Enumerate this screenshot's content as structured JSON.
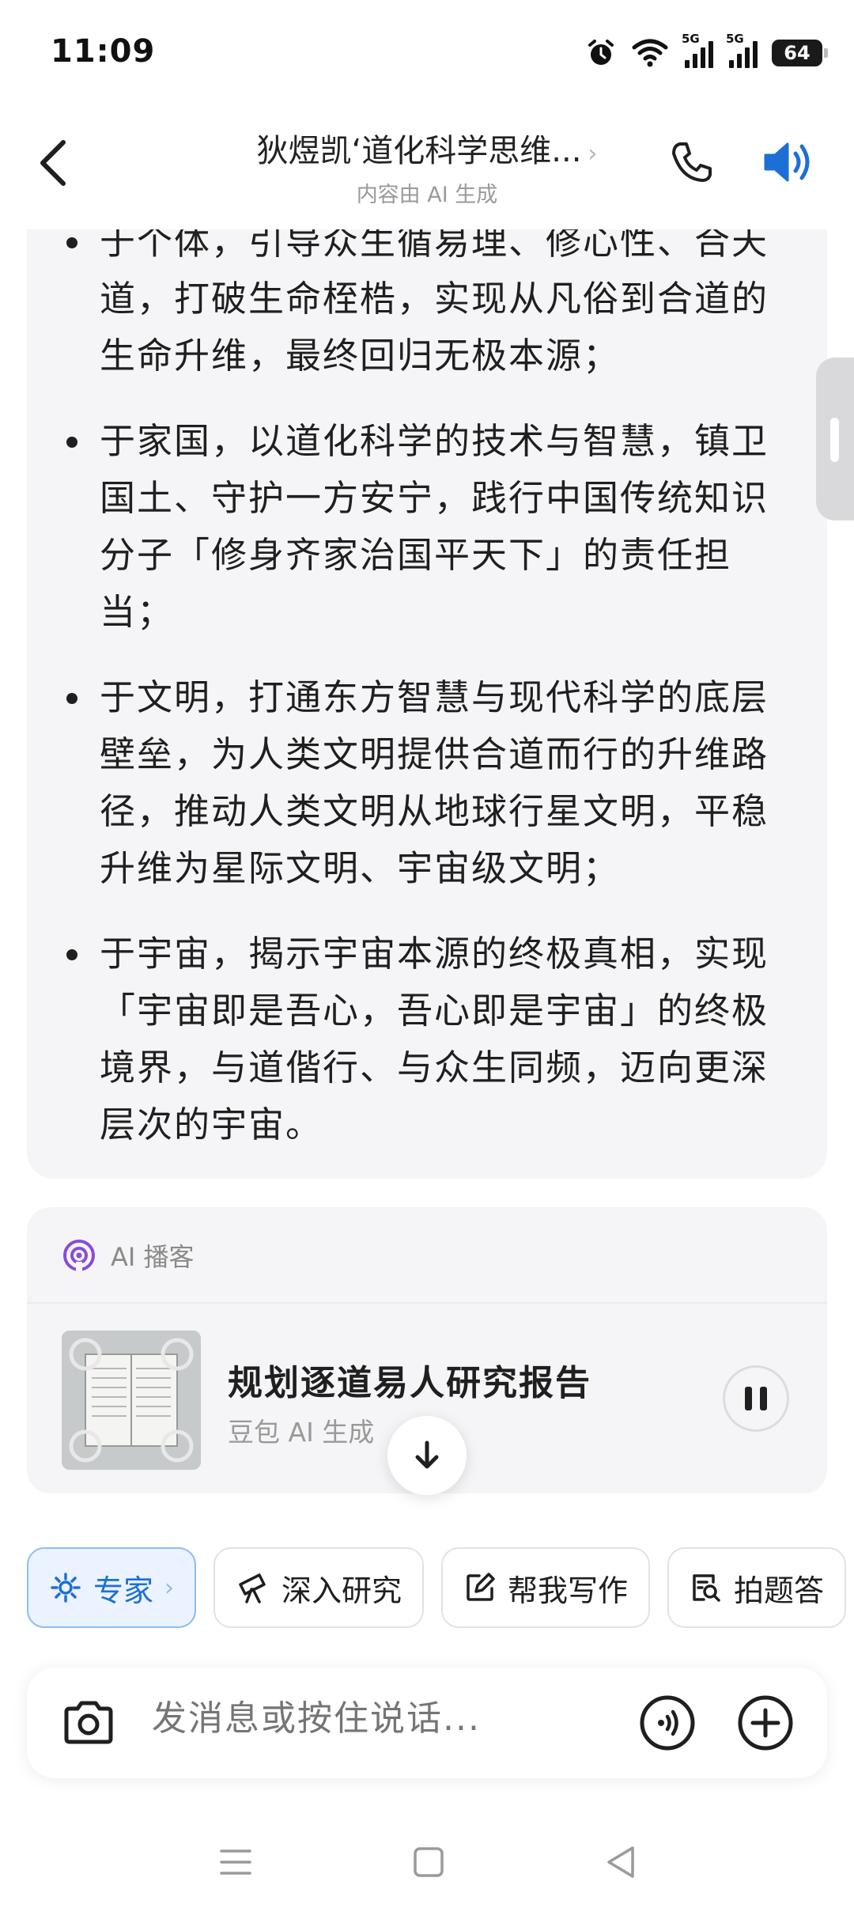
{
  "status_bar": {
    "time": "11:09",
    "battery": "64",
    "network_1": "5G",
    "network_2": "5G"
  },
  "header": {
    "title": "狄煜凯‘道化科学思维...",
    "title_chevron": "›",
    "subtitle": "内容由 AI 生成"
  },
  "message": {
    "items": [
      "于个体，引导众生循易理、修心性、合天道，打破生命桎梏，实现从凡俗到合道的生命升维，最终回归无极本源；",
      "于家国，以道化科学的技术与智慧，镇卫国土、守护一方安宁，践行中国传统知识分子「修身齐家治国平天下」的责任担当；",
      "于文明，打通东方智慧与现代科学的底层壁垒，为人类文明提供合道而行的升维路径，推动人类文明从地球行星文明，平稳升维为星际文明、宇宙级文明；",
      "于宇宙，揭示宇宙本源的终极真相，实现「宇宙即是吾心，吾心即是宇宙」的终极境界，与道偕行、与众生同频，迈向更深层次的宇宙。"
    ]
  },
  "podcast": {
    "label": "AI 播客",
    "title": "规划逐道易人研究报告",
    "subtitle": "豆包 AI 生成"
  },
  "chips": [
    {
      "label": "专家",
      "suffix": "›",
      "icon": "expert-icon"
    },
    {
      "label": "深入研究",
      "icon": "telescope-icon"
    },
    {
      "label": "帮我写作",
      "icon": "edit-icon"
    },
    {
      "label": "拍题答",
      "icon": "scan-doc-icon"
    }
  ],
  "input": {
    "placeholder": "发消息或按住说话..."
  },
  "colors": {
    "accent": "#1d6fd6",
    "podcast_icon": "#8a4bd6",
    "card_bg": "#f5f5f7"
  }
}
